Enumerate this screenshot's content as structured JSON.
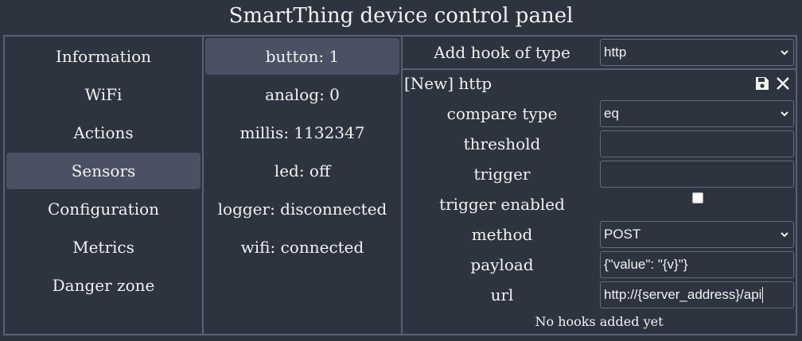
{
  "app": {
    "title": "SmartThing device control panel"
  },
  "menu": {
    "items": [
      {
        "label": "Information"
      },
      {
        "label": "WiFi"
      },
      {
        "label": "Actions"
      },
      {
        "label": "Sensors"
      },
      {
        "label": "Configuration"
      },
      {
        "label": "Metrics"
      },
      {
        "label": "Danger zone"
      }
    ],
    "active": "Sensors"
  },
  "sensors": {
    "items": [
      {
        "label": "button: 1"
      },
      {
        "label": "analog: 0"
      },
      {
        "label": "millis: 1132347"
      },
      {
        "label": "led: off"
      },
      {
        "label": "logger: disconnected"
      },
      {
        "label": "wifi: connected"
      }
    ],
    "active": "button: 1"
  },
  "hooks": {
    "add_label": "Add hook of type",
    "add_value": "http",
    "new_title": "[New] http",
    "fields": {
      "compare_type": {
        "label": "compare type",
        "value": "eq"
      },
      "threshold": {
        "label": "threshold",
        "value": ""
      },
      "trigger": {
        "label": "trigger",
        "value": ""
      },
      "trigger_enabled": {
        "label": "trigger enabled",
        "checked": false
      },
      "method": {
        "label": "method",
        "value": "POST"
      },
      "payload": {
        "label": "payload",
        "value": "{\"value\": \"{v}\"}"
      },
      "url": {
        "label": "url",
        "value": "http://{server_address}/api"
      }
    },
    "empty_text": "No hooks added yet"
  },
  "icons": {
    "save": "floppy-disk-icon",
    "close": "close-icon",
    "dropdown": "chevron-down-icon"
  },
  "colors": {
    "background": "#2e3340",
    "active": "#4a5163",
    "border": "#5a6175"
  }
}
